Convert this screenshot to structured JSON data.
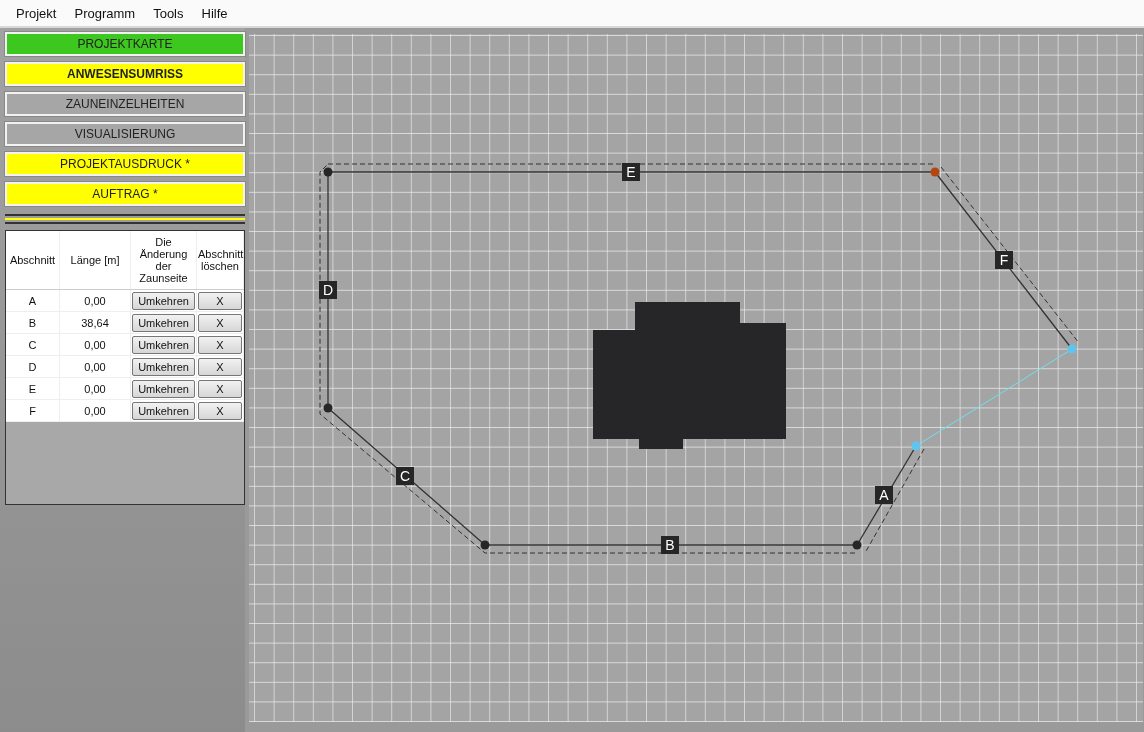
{
  "menu": [
    "Projekt",
    "Programm",
    "Tools",
    "Hilfe"
  ],
  "nav_buttons": [
    {
      "label": "PROJEKTKARTE",
      "color": "#3cc81e",
      "selected": false
    },
    {
      "label": "ANWESENSUMRISS",
      "color": "#ffff00",
      "selected": true
    },
    {
      "label": "ZAUNEINZELHEITEN",
      "color": "#a6a6a6",
      "selected": false
    },
    {
      "label": "VISUALISIERUNG",
      "color": "#a6a6a6",
      "selected": false
    },
    {
      "label": "PROJEKTAUSDRUCK *",
      "color": "#ffff00",
      "selected": false
    },
    {
      "label": "AUFTRAG *",
      "color": "#ffff00",
      "selected": false
    }
  ],
  "table": {
    "columns": [
      "Abschnitt",
      "Länge [m]",
      "Die Änderung der Zaunseite",
      "Abschnitt löschen"
    ],
    "rows": [
      {
        "section": "A",
        "length": "0,00",
        "reverse": "Umkehren",
        "delete": "X"
      },
      {
        "section": "B",
        "length": "38,64",
        "reverse": "Umkehren",
        "delete": "X"
      },
      {
        "section": "C",
        "length": "0,00",
        "reverse": "Umkehren",
        "delete": "X"
      },
      {
        "section": "D",
        "length": "0,00",
        "reverse": "Umkehren",
        "delete": "X"
      },
      {
        "section": "E",
        "length": "0,00",
        "reverse": "Umkehren",
        "delete": "X"
      },
      {
        "section": "F",
        "length": "0,00",
        "reverse": "Umkehren",
        "delete": "X"
      }
    ]
  },
  "map": {
    "segment_labels": [
      "A",
      "B",
      "C",
      "D",
      "E",
      "F"
    ],
    "vertices": [
      {
        "kind": "open-end"
      },
      {
        "kind": "normal"
      },
      {
        "kind": "normal"
      },
      {
        "kind": "normal"
      },
      {
        "kind": "normal"
      },
      {
        "kind": "selected"
      },
      {
        "kind": "open-end"
      }
    ]
  }
}
